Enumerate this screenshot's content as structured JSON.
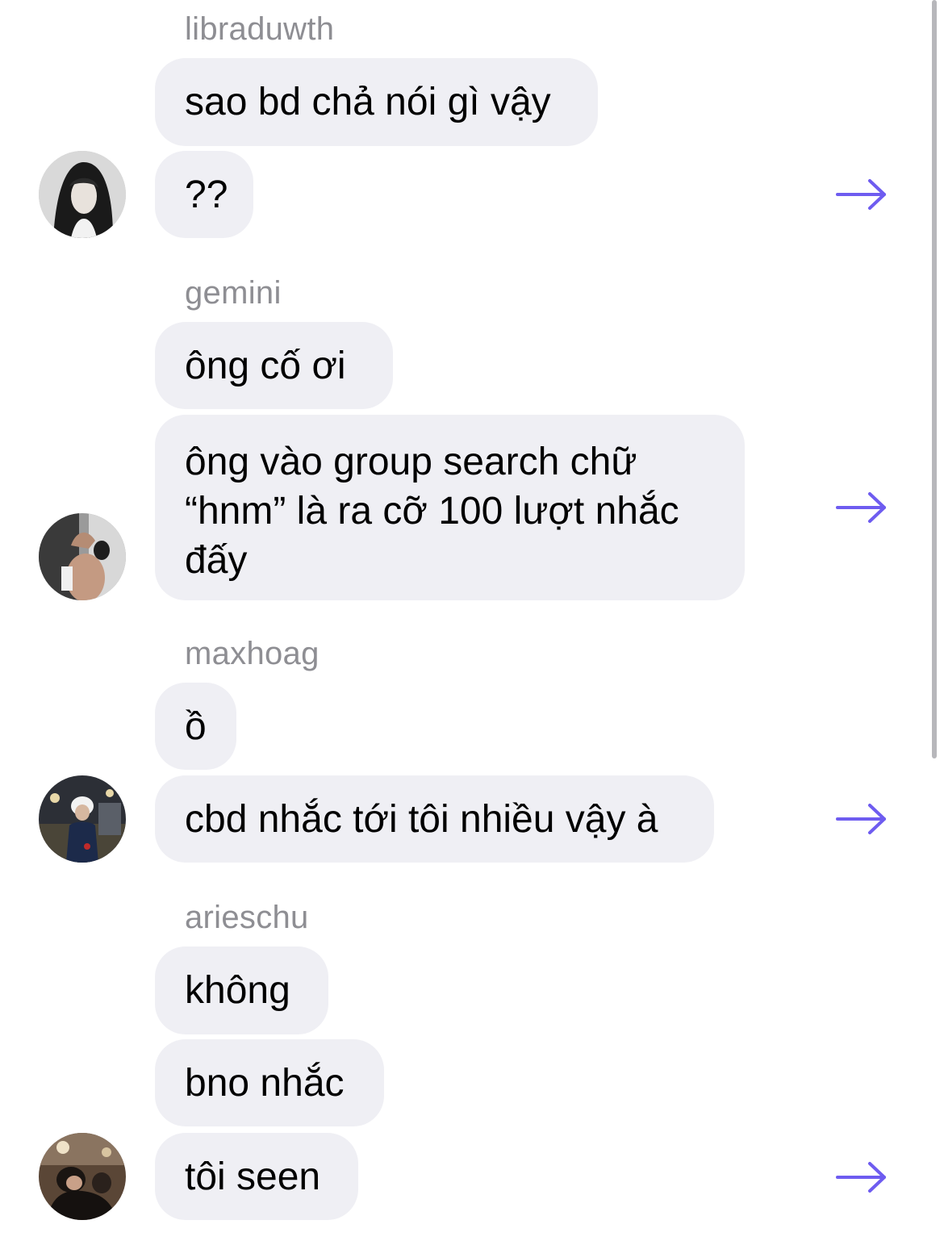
{
  "colors": {
    "bubble_bg": "#efeff4",
    "username_text": "#8e8e93",
    "share_accent": "#6e5cf0"
  },
  "messages": [
    {
      "username": "libraduwth",
      "bubbles": [
        "sao bd chả nói gì vậy",
        "??"
      ],
      "share_icon": "arrow-right-icon"
    },
    {
      "username": "gemini",
      "bubbles": [
        "ông cố ơi"
      ],
      "multiline_bubble": [
        "ông vào group search chữ",
        "“hnm” là ra cỡ 100 lượt nhắc",
        "đấy"
      ],
      "share_icon": "arrow-right-icon"
    },
    {
      "username": "maxhoag",
      "bubbles": [
        "ồ",
        "cbd nhắc tới tôi nhiều vậy à"
      ],
      "share_icon": "arrow-right-icon"
    },
    {
      "username": "arieschu",
      "bubbles": [
        "không",
        "bno nhắc",
        "tôi seen"
      ],
      "share_icon": "arrow-right-icon"
    }
  ]
}
